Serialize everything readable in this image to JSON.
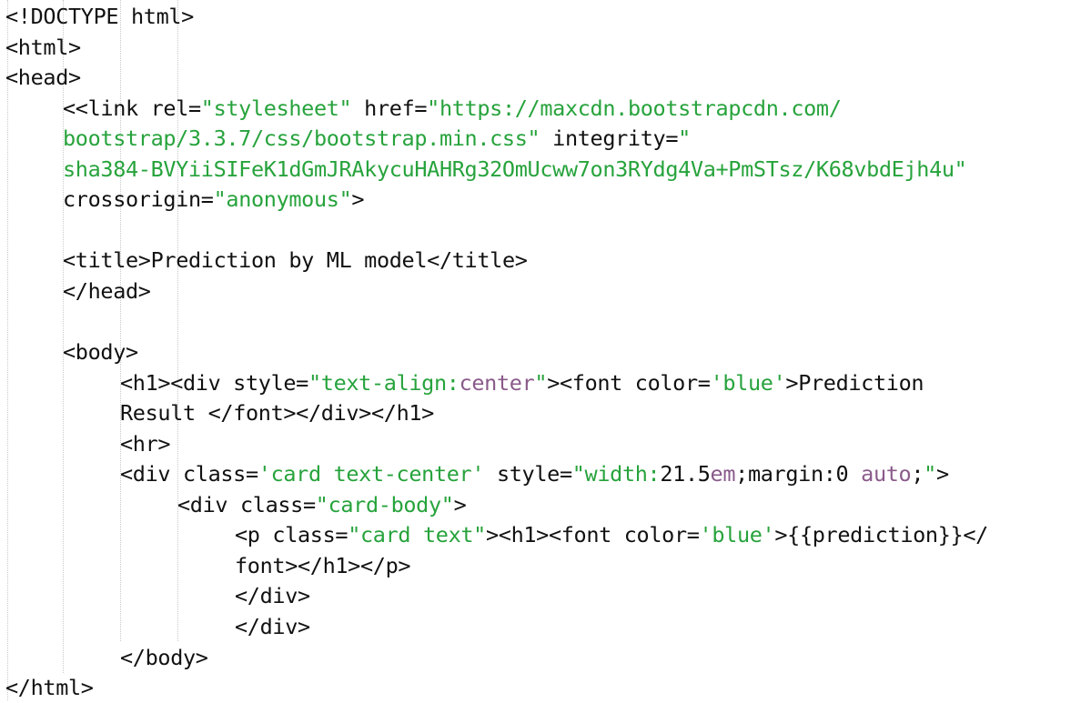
{
  "editor": {
    "colors": {
      "default": "#111111",
      "string": "#27a33c",
      "unit": "#8a5a8a",
      "guide": "#c9c9c9"
    },
    "lines": [
      {
        "indent": 0,
        "tokens": [
          {
            "t": "tag",
            "v": "<!DOCTYPE html>"
          }
        ]
      },
      {
        "indent": 0,
        "tokens": [
          {
            "t": "tag",
            "v": "<html>"
          }
        ]
      },
      {
        "indent": 0,
        "tokens": [
          {
            "t": "tag",
            "v": "<head>"
          }
        ]
      },
      {
        "indent": 1,
        "tokens": [
          {
            "t": "tag",
            "v": "<<link rel="
          },
          {
            "t": "str",
            "v": "\"stylesheet\""
          },
          {
            "t": "tag",
            "v": " href="
          },
          {
            "t": "str",
            "v": "\"https://maxcdn.bootstrapcdn.com/"
          }
        ]
      },
      {
        "indent": 1,
        "tokens": [
          {
            "t": "str",
            "v": "bootstrap/3.3.7/css/bootstrap.min.css\""
          },
          {
            "t": "tag",
            "v": " integrity="
          },
          {
            "t": "str",
            "v": "\""
          }
        ]
      },
      {
        "indent": 1,
        "tokens": [
          {
            "t": "str",
            "v": "sha384-BVYiiSIFeK1dGmJRAkycuHAHRg32OmUcww7on3RYdg4Va+PmSTsz/K68vbdEjh4u\""
          }
        ]
      },
      {
        "indent": 1,
        "tokens": [
          {
            "t": "tag",
            "v": "crossorigin="
          },
          {
            "t": "str",
            "v": "\"anonymous\""
          },
          {
            "t": "tag",
            "v": ">"
          }
        ]
      },
      {
        "indent": 1,
        "tokens": []
      },
      {
        "indent": 1,
        "tokens": [
          {
            "t": "tag",
            "v": "<title>"
          },
          {
            "t": "plain",
            "v": "Prediction by ML model"
          },
          {
            "t": "tag",
            "v": "</title>"
          }
        ]
      },
      {
        "indent": 1,
        "tokens": [
          {
            "t": "tag",
            "v": "</head>"
          }
        ]
      },
      {
        "indent": 1,
        "tokens": []
      },
      {
        "indent": 1,
        "tokens": [
          {
            "t": "tag",
            "v": "<body>"
          }
        ]
      },
      {
        "indent": 2,
        "tokens": [
          {
            "t": "tag",
            "v": "<h1><div style="
          },
          {
            "t": "str",
            "v": "\"text-align:"
          },
          {
            "t": "unit",
            "v": "center"
          },
          {
            "t": "str",
            "v": "\""
          },
          {
            "t": "tag",
            "v": "><font color="
          },
          {
            "t": "str",
            "v": "'blue'"
          },
          {
            "t": "tag",
            "v": ">"
          },
          {
            "t": "plain",
            "v": "Prediction"
          }
        ]
      },
      {
        "indent": 2,
        "tokens": [
          {
            "t": "plain",
            "v": "Result "
          },
          {
            "t": "tag",
            "v": "</font></div></h1>"
          }
        ]
      },
      {
        "indent": 2,
        "tokens": [
          {
            "t": "tag",
            "v": "<hr>"
          }
        ]
      },
      {
        "indent": 2,
        "tokens": [
          {
            "t": "tag",
            "v": "<div class="
          },
          {
            "t": "str",
            "v": "'card text-center'"
          },
          {
            "t": "tag",
            "v": " style="
          },
          {
            "t": "str",
            "v": "\"width:"
          },
          {
            "t": "num",
            "v": "21.5"
          },
          {
            "t": "unit",
            "v": "em"
          },
          {
            "t": "tag",
            "v": ";margin:"
          },
          {
            "t": "num",
            "v": "0"
          },
          {
            "t": "unit",
            "v": " auto"
          },
          {
            "t": "tag",
            "v": ";"
          },
          {
            "t": "str",
            "v": "\""
          },
          {
            "t": "tag",
            "v": ">"
          }
        ]
      },
      {
        "indent": 3,
        "tokens": [
          {
            "t": "tag",
            "v": "<div class="
          },
          {
            "t": "str",
            "v": "\"card-body\""
          },
          {
            "t": "tag",
            "v": ">"
          }
        ]
      },
      {
        "indent": 4,
        "tokens": [
          {
            "t": "tag",
            "v": "<p class="
          },
          {
            "t": "str",
            "v": "\"card text\""
          },
          {
            "t": "tag",
            "v": "><h1><font color="
          },
          {
            "t": "str",
            "v": "'blue'"
          },
          {
            "t": "tag",
            "v": ">"
          },
          {
            "t": "plain",
            "v": "{{prediction}}"
          },
          {
            "t": "tag",
            "v": "</"
          }
        ]
      },
      {
        "indent": 4,
        "tokens": [
          {
            "t": "tag",
            "v": "font></h1></p>"
          }
        ]
      },
      {
        "indent": 4,
        "tokens": [
          {
            "t": "tag",
            "v": "</div>"
          }
        ]
      },
      {
        "indent": 4,
        "tokens": [
          {
            "t": "tag",
            "v": "</div>"
          }
        ]
      },
      {
        "indent": 2,
        "tokens": [
          {
            "t": "tag",
            "v": "</body>"
          }
        ]
      },
      {
        "indent": 0,
        "tokens": [
          {
            "t": "tag",
            "v": "</html>"
          }
        ]
      }
    ]
  }
}
